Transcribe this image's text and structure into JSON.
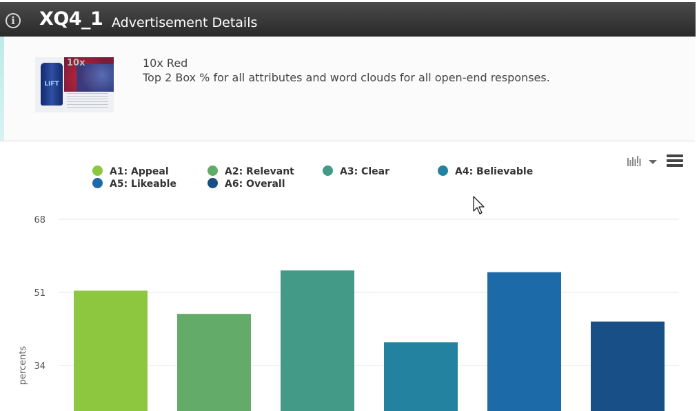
{
  "header": {
    "title": "XQ4_1",
    "subtitle": "Advertisement Details",
    "info_icon": "info-circle-icon"
  },
  "ad": {
    "name": "10x Red",
    "description": "Top 2 Box % for all attributes and word clouds for all open-end responses.",
    "thumbnail": {
      "badge": "10x",
      "brand": "LIFT"
    }
  },
  "toolbar": {
    "chart_type_icon": "bar-chart-dropdown-icon",
    "menu_icon": "hamburger-menu-icon"
  },
  "colors": {
    "A1": "#8dc63f",
    "A2": "#62ab68",
    "A3": "#439a87",
    "A4": "#22829f",
    "A5": "#1c6aa8",
    "A6": "#174f86"
  },
  "chart_data": {
    "type": "bar",
    "ylabel": "percents",
    "yticks": [
      34,
      51,
      68
    ],
    "ylim": [
      23,
      68
    ],
    "grid": true,
    "legend_position": "top",
    "series": [
      {
        "name": "A1: Appeal",
        "value": 51.4,
        "color": "#8dc63f"
      },
      {
        "name": "A2: Relevant",
        "value": 46.0,
        "color": "#62ab68"
      },
      {
        "name": "A3: Clear",
        "value": 56.1,
        "color": "#439a87"
      },
      {
        "name": "A4: Believable",
        "value": 39.4,
        "color": "#22829f"
      },
      {
        "name": "A5: Likeable",
        "value": 55.7,
        "color": "#1c6aa8"
      },
      {
        "name": "A6: Overall",
        "value": 44.2,
        "color": "#174f86"
      }
    ]
  }
}
